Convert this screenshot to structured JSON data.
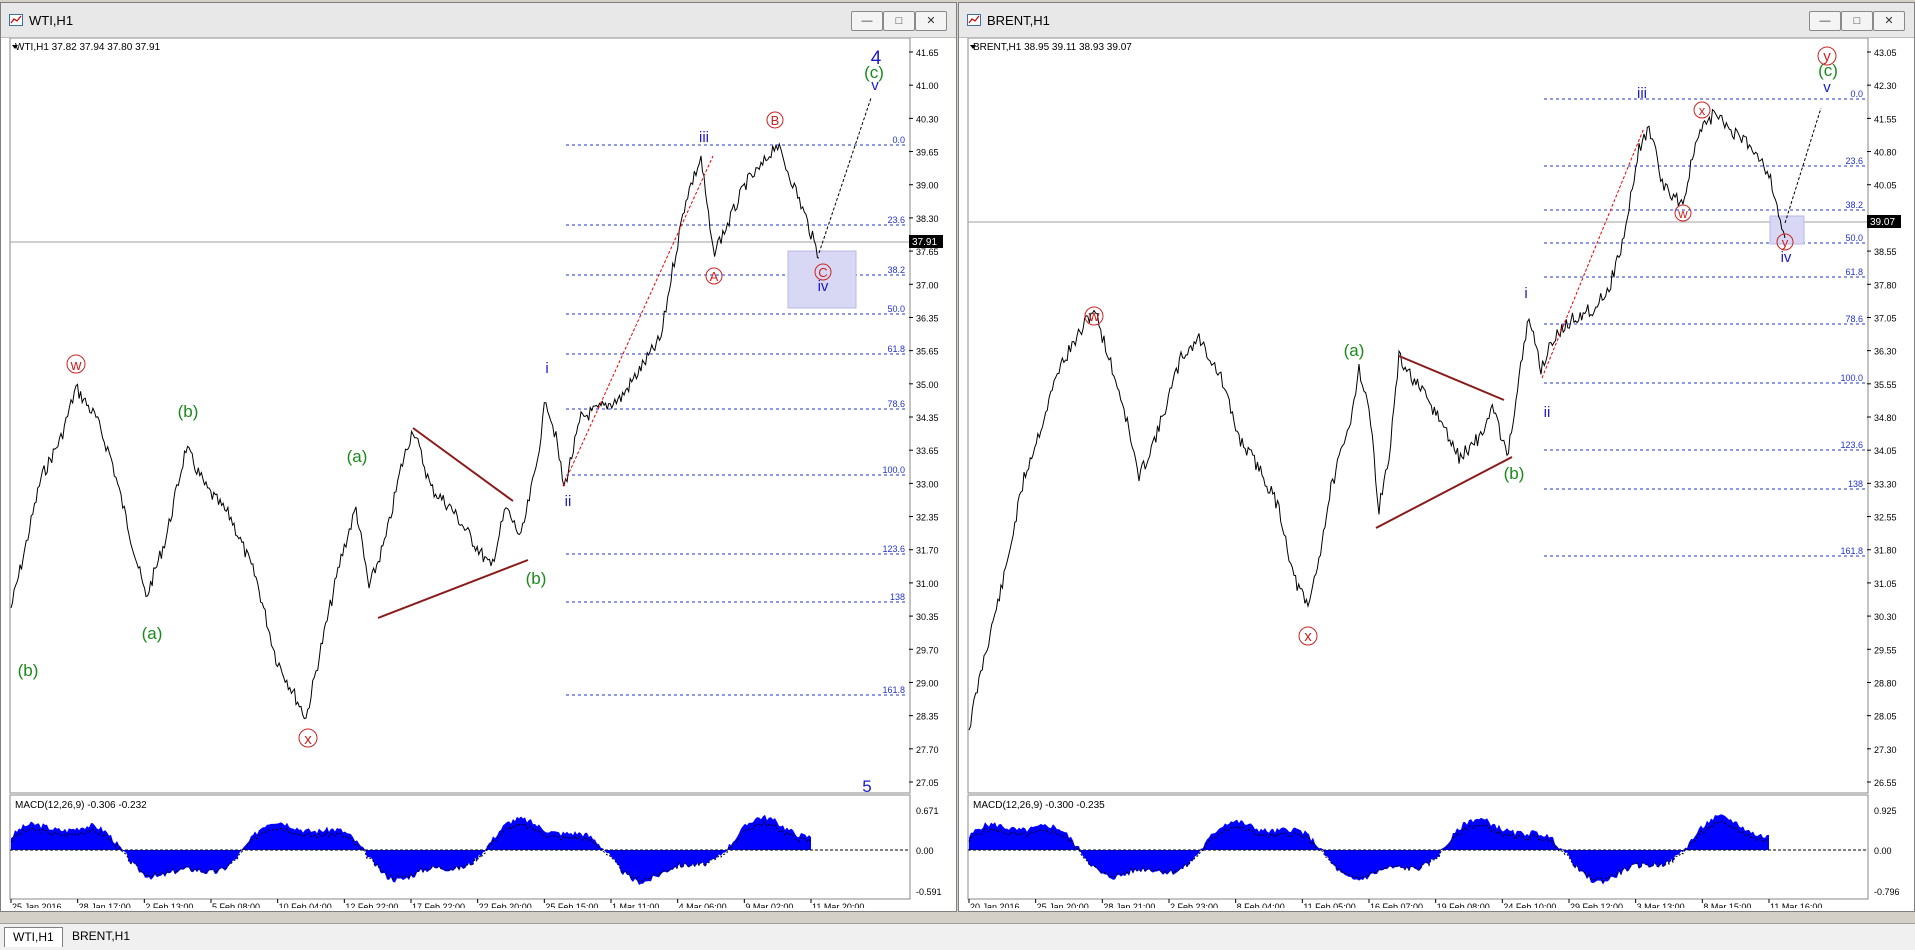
{
  "windows": [
    {
      "title": "WTI,H1",
      "info": "WTI,H1  37.82 37.94 37.80 37.91",
      "price_tag": "37.91",
      "y_ticks": [
        "41.65",
        "41.00",
        "40.30",
        "39.65",
        "39.00",
        "38.30",
        "37.65",
        "37.00",
        "36.35",
        "35.65",
        "35.00",
        "34.35",
        "33.65",
        "33.00",
        "32.35",
        "31.70",
        "31.00",
        "30.35",
        "29.70",
        "29.00",
        "28.35",
        "27.70",
        "27.05"
      ],
      "x_ticks": [
        "25 Jan 2016",
        "28 Jan 17:00",
        "2 Feb 13:00",
        "5 Feb 08:00",
        "10 Feb 04:00",
        "12 Feb 22:00",
        "17 Feb 22:00",
        "22 Feb 20:00",
        "25 Feb 15:00",
        "1 Mar 11:00",
        "4 Mar 06:00",
        "9 Mar 02:00",
        "11 Mar 20:00"
      ],
      "fib_levels": [
        "0.0",
        "23.6",
        "38.2",
        "50.0",
        "61.8",
        "78.6",
        "100.0",
        "123.6",
        "138",
        "161.8"
      ],
      "macd_label": "MACD(12,26,9) -0.306 -0.232",
      "macd_ticks": [
        "0.671",
        "0.00",
        "-0.591"
      ],
      "wave_labels": {
        "w": "w",
        "x": "x",
        "b1": "(b)",
        "a1": "(a)",
        "b2": "(b)",
        "a2": "(a)",
        "b3": "(b)",
        "i": "i",
        "ii": "ii",
        "iii": "iii",
        "iv": "iv",
        "v": "v",
        "A": "A",
        "B": "B",
        "C": "C",
        "c": "(c)",
        "four": "4",
        "five": "5"
      }
    },
    {
      "title": "BRENT,H1",
      "info": "BRENT,H1  38.95 39.11 38.93 39.07",
      "price_tag": "39.07",
      "y_ticks": [
        "43.05",
        "42.30",
        "41.55",
        "40.80",
        "40.05",
        "39.30",
        "38.55",
        "37.80",
        "37.05",
        "36.30",
        "35.55",
        "34.80",
        "34.05",
        "33.30",
        "32.55",
        "31.80",
        "31.05",
        "30.30",
        "29.55",
        "28.80",
        "28.05",
        "27.30",
        "26.55"
      ],
      "x_ticks": [
        "20 Jan 2016",
        "25 Jan 20:00",
        "28 Jan 21:00",
        "2 Feb 23:00",
        "8 Feb 04:00",
        "11 Feb 05:00",
        "16 Feb 07:00",
        "19 Feb 08:00",
        "24 Feb 10:00",
        "29 Feb 12:00",
        "3 Mar 13:00",
        "8 Mar 15:00",
        "11 Mar 16:00"
      ],
      "fib_levels": [
        "0.0",
        "23.6",
        "38.2",
        "50.0",
        "61.8",
        "78.6",
        "100.0",
        "123.6",
        "138",
        "161.8"
      ],
      "macd_label": "MACD(12,26,9) -0.300 -0.235",
      "macd_ticks": [
        "0.925",
        "0.00",
        "-0.796"
      ],
      "wave_labels": {
        "w": "w",
        "x": "x",
        "a": "(a)",
        "b": "(b)",
        "i": "i",
        "ii": "ii",
        "iii": "iii",
        "iv": "iv",
        "v": "v",
        "W": "w",
        "X": "x",
        "Y": "y",
        "y": "y",
        "c": "(c)"
      }
    }
  ],
  "tabs": [
    "WTI,H1",
    "BRENT,H1"
  ],
  "colors": {
    "wave_green": "#1a8a1a",
    "wave_red": "#cc2222",
    "wave_blue": "#1a1acc",
    "fib_blue": "#2233cc",
    "macd_fill": "#0000ff"
  }
}
